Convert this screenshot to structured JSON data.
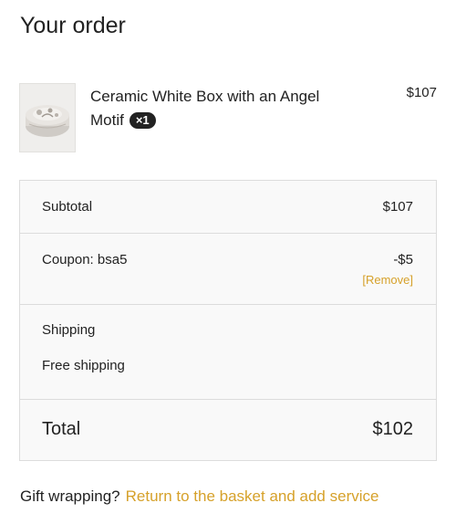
{
  "page": {
    "title": "Your order"
  },
  "order_item": {
    "name": "Ceramic White Box with an Angel Motif",
    "quantity": "×1",
    "price": "$107",
    "thumbnail_icon": "ceramic-box-image"
  },
  "summary": {
    "subtotal_label": "Subtotal",
    "subtotal_value": "$107",
    "coupon_label": "Coupon: bsa5",
    "coupon_value": "-$5",
    "coupon_remove": "[Remove]",
    "shipping_label": "Shipping",
    "shipping_method": "Free shipping",
    "total_label": "Total",
    "total_value": "$102"
  },
  "gift": {
    "question": "Gift wrapping?",
    "link_text": "Return to the basket and add service"
  },
  "colors": {
    "accent": "#d6a12a",
    "text": "#222222",
    "summary_bg": "#f9f9f9",
    "border": "#dcdcdc"
  }
}
